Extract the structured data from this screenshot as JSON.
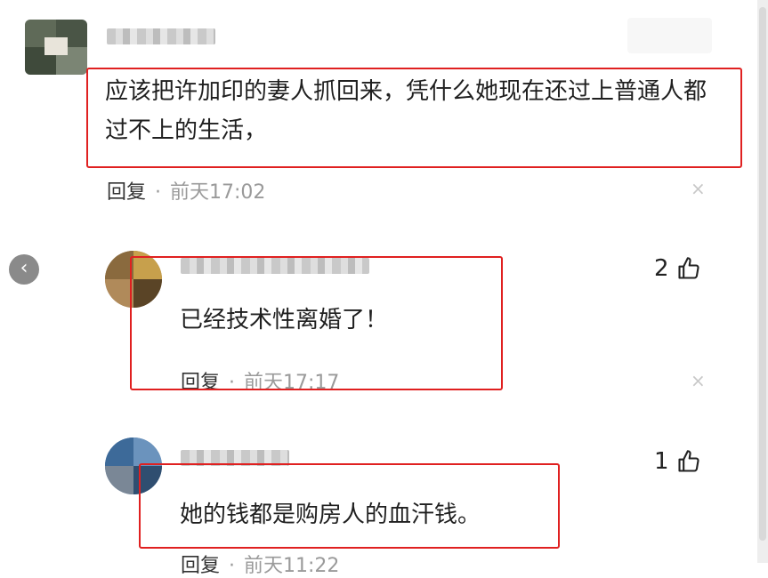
{
  "comments": [
    {
      "text": "应该把许加印的妻人抓回来，凭什么她现在还过上普通人都过不上的生活，",
      "reply_label": "回复",
      "separator": "·",
      "time": "前天17:02",
      "close_symbol": "×"
    },
    {
      "text": "已经技术性离婚了！",
      "reply_label": "回复",
      "separator": "·",
      "time": "前天17:17",
      "close_symbol": "×",
      "likes": "2"
    },
    {
      "text": "她的钱都是购房人的血汗钱。",
      "reply_label": "回复",
      "separator": "·",
      "time": "前天11:22",
      "likes": "1"
    }
  ],
  "back_symbol": "‹",
  "colors": {
    "highlight": "#e02020",
    "muted": "#9a9a9a"
  },
  "icons": [
    "thumbs-up-icon",
    "close-icon",
    "chevron-left-icon"
  ]
}
